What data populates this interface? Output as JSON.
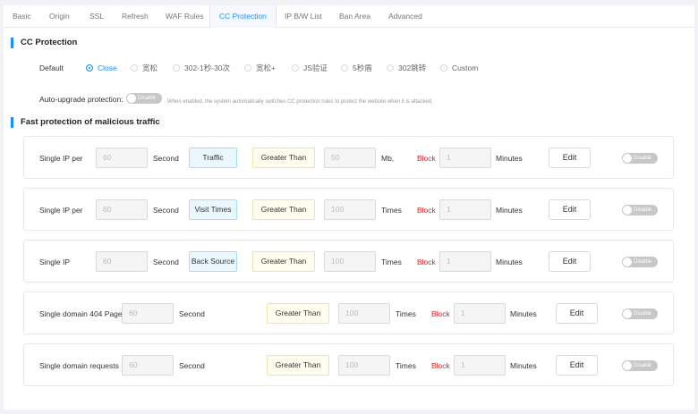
{
  "tabs": [
    "Basic",
    "Origin",
    "SSL",
    "Refresh",
    "WAF Rules",
    "CC Protection",
    "IP B/W List",
    "Ban Area",
    "Advanced"
  ],
  "cc": {
    "title": "CC Protection",
    "default_label": "Default",
    "options": [
      "Close",
      "宽松",
      "302-1秒-30次",
      "宽松+",
      "JS验证",
      "5秒盾",
      "302跳转",
      "Custom"
    ],
    "selected": "Close",
    "auto_upgrade_label": "Auto-upgrade protection:",
    "auto_upgrade_toggle": "Disable",
    "auto_upgrade_hint": "When enabled, the system automatically switches CC protection rules to protect the website when it is attacked."
  },
  "fast": {
    "title": "Fast protection of malicious traffic",
    "rules": [
      {
        "label": "Single IP per",
        "seconds": "60",
        "seconds_unit": "Second",
        "metric": "Traffic",
        "comparator": "Greater Than",
        "threshold": "50",
        "threshold_unit": "Mb,",
        "action": "Block",
        "duration": "1",
        "duration_unit": "Minutes",
        "edit": "Edit",
        "toggle": "Disable"
      },
      {
        "label": "Single IP per",
        "seconds": "60",
        "seconds_unit": "Second",
        "metric": "Visit Times",
        "comparator": "Greater Than",
        "threshold": "100",
        "threshold_unit": "Times",
        "action": "Block",
        "duration": "1",
        "duration_unit": "Minutes",
        "edit": "Edit",
        "toggle": "Disable"
      },
      {
        "label": "Single IP",
        "seconds": "60",
        "seconds_unit": "Second",
        "metric": "Back Source",
        "comparator": "Greater Than",
        "threshold": "100",
        "threshold_unit": "Times",
        "action": "Block",
        "duration": "1",
        "duration_unit": "Minutes",
        "edit": "Edit",
        "toggle": "Disable"
      },
      {
        "label": "Single domain 404 Page",
        "seconds": "60",
        "seconds_unit": "Second",
        "comparator": "Greater Than",
        "threshold": "100",
        "threshold_unit": "Times",
        "action": "Block",
        "duration": "1",
        "duration_unit": "Minutes",
        "edit": "Edit",
        "toggle": "Disable"
      },
      {
        "label": "Single domain requests",
        "seconds": "60",
        "seconds_unit": "Second",
        "comparator": "Greater Than",
        "threshold": "100",
        "threshold_unit": "Times",
        "action": "Block",
        "duration": "1",
        "duration_unit": "Minutes",
        "edit": "Edit",
        "toggle": "Disable"
      }
    ]
  },
  "colors": {
    "accent": "#1890ff",
    "block": "#e51c23"
  }
}
